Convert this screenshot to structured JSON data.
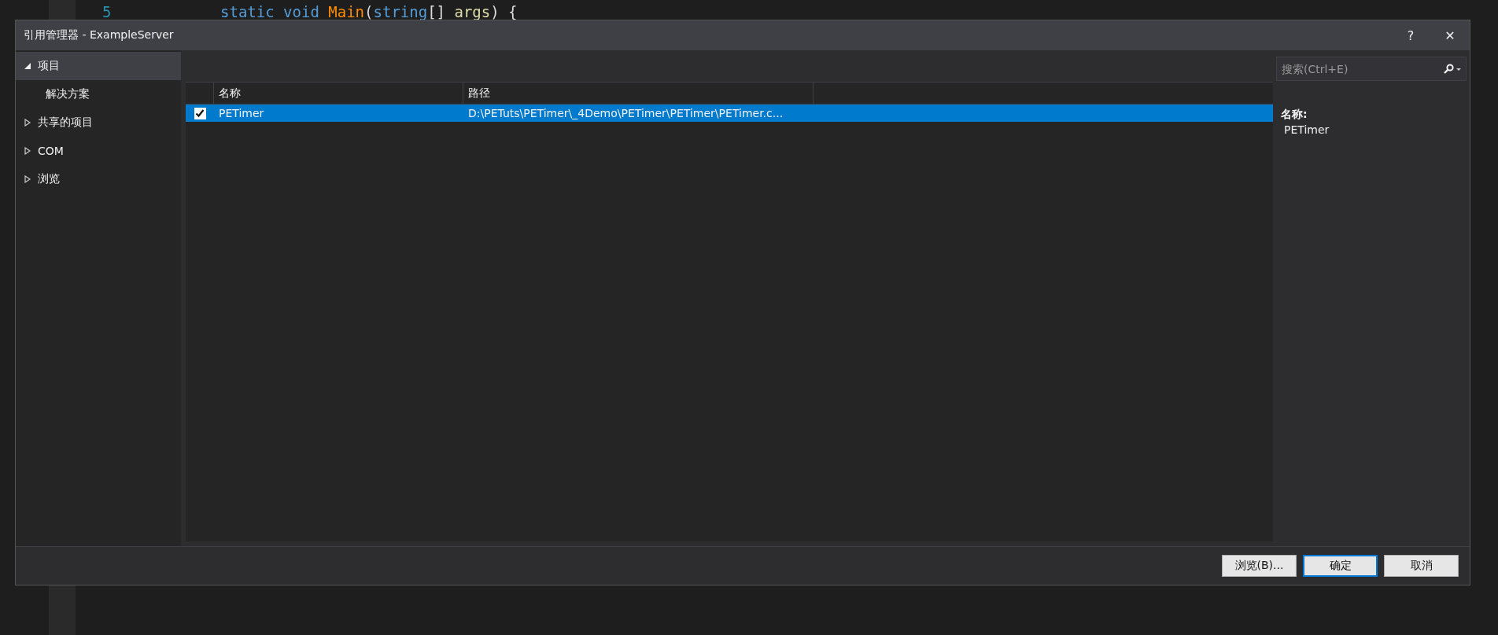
{
  "editor": {
    "lines": [
      {
        "number": "5",
        "tokens": [
          {
            "text": "static void ",
            "kind": "keyword"
          },
          {
            "text": "Main",
            "kind": "method"
          },
          {
            "text": "(",
            "kind": "plain"
          },
          {
            "text": "string",
            "kind": "keyword"
          },
          {
            "text": "[] ",
            "kind": "plain"
          },
          {
            "text": "args",
            "kind": "param"
          },
          {
            "text": ") {",
            "kind": "plain"
          }
        ]
      }
    ]
  },
  "dialog": {
    "title": "引用管理器 - ExampleServer",
    "title_buttons": [
      "?",
      "✕"
    ],
    "sidebar": {
      "items": [
        {
          "label": "项目",
          "expanded": true,
          "selected": true,
          "children": [
            {
              "label": "解决方案",
              "selected": false
            }
          ]
        },
        {
          "label": "共享的项目",
          "expanded": false,
          "selected": false
        },
        {
          "label": "COM",
          "expanded": false,
          "selected": false
        },
        {
          "label": "浏览",
          "expanded": false,
          "selected": false
        }
      ]
    },
    "search": {
      "placeholder": "搜索(Ctrl+E)"
    },
    "table": {
      "columns": [
        "名称",
        "路径"
      ],
      "rows": [
        {
          "name": "PETimer",
          "path": "D:\\PETuts\\PETimer\\_4Demo\\PETimer\\PETimer\\PETimer.c...",
          "checked": true,
          "selected": true
        }
      ]
    },
    "details": {
      "label": "名称:",
      "value": "PETimer"
    },
    "buttons": [
      {
        "label": "浏览(B)...",
        "kind": "normal"
      },
      {
        "label": "确定",
        "kind": "default"
      },
      {
        "label": "取消",
        "kind": "normal"
      }
    ]
  }
}
